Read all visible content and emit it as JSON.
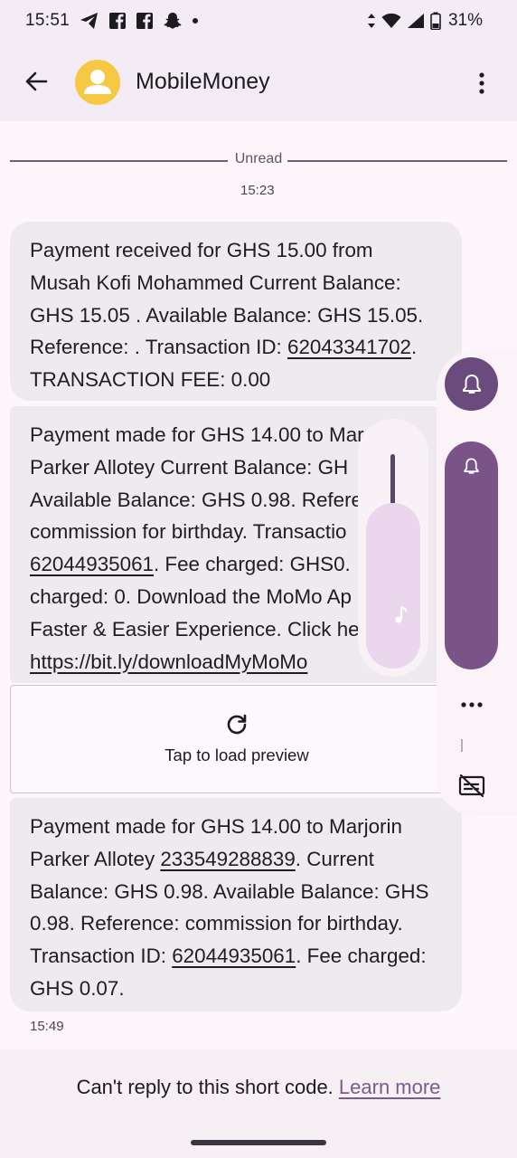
{
  "status_bar": {
    "time": "15:51",
    "battery": "31%",
    "icons": [
      "telegram-icon",
      "facebook-icon",
      "facebook-icon",
      "snapchat-icon",
      "dot-icon",
      "data-arrows-icon",
      "wifi-icon",
      "signal-icon",
      "battery-icon"
    ]
  },
  "app_bar": {
    "title": "MobileMoney",
    "icons": [
      "back-arrow-icon",
      "avatar-person-icon",
      "more-vert-icon"
    ]
  },
  "thread": {
    "unread_label": "Unread",
    "first_time": "15:23",
    "last_time": "15:49"
  },
  "messages": [
    {
      "lines": [
        "Payment received for GHS 15.00 from",
        "Musah Kofi Mohammed  Current Balance:",
        "GHS 15.05 . Available Balance: GHS 15.05.",
        "Reference: . Transaction ID: ",
        "TRANSACTION FEE: 0.00"
      ],
      "link": "62043341702",
      "after_link": "."
    },
    {
      "lines": [
        "Payment made for GHS 14.00 to Mar",
        "Parker Allotey Current Balance: GH",
        "Available Balance: GHS 0.98. Refere",
        "commission for birthday. Transactio",
        ". Fee charged: GHS0.",
        "charged: 0. Download the MoMo Ap",
        "Faster & Easier Experience. Click he"
      ],
      "link_1": "62044935061",
      "link_2": "https://bit.ly/downloadMyMoMo",
      "preview_label": "Tap to load preview"
    },
    {
      "line_1": "Payment made for GHS 14.00 to Marjorin",
      "line_2_pre": "Parker Allotey ",
      "line_2_link": "233549288839",
      "line_2_post": ". Current",
      "line_3": "Balance: GHS 0.98. Available Balance: GHS",
      "line_4": "0.98. Reference: commission for birthday.",
      "line_5_pre": "Transaction ID: ",
      "line_5_link": "62044935061",
      "line_5_post": ". Fee charged:",
      "line_6": "GHS 0.07."
    }
  ],
  "footer": {
    "text": "Can't reply to this short code. ",
    "link": "Learn more"
  },
  "volume_overlay": {
    "ring_level": 1.0,
    "media_level": 0.72,
    "icons": [
      "bell-icon",
      "bell-icon",
      "music-note-icon",
      "more-horiz-icon",
      "captions-off-icon"
    ]
  },
  "colors": {
    "accent": "#6b4a7e",
    "avatar": "#f7c843",
    "link": "#7a5c8c"
  }
}
